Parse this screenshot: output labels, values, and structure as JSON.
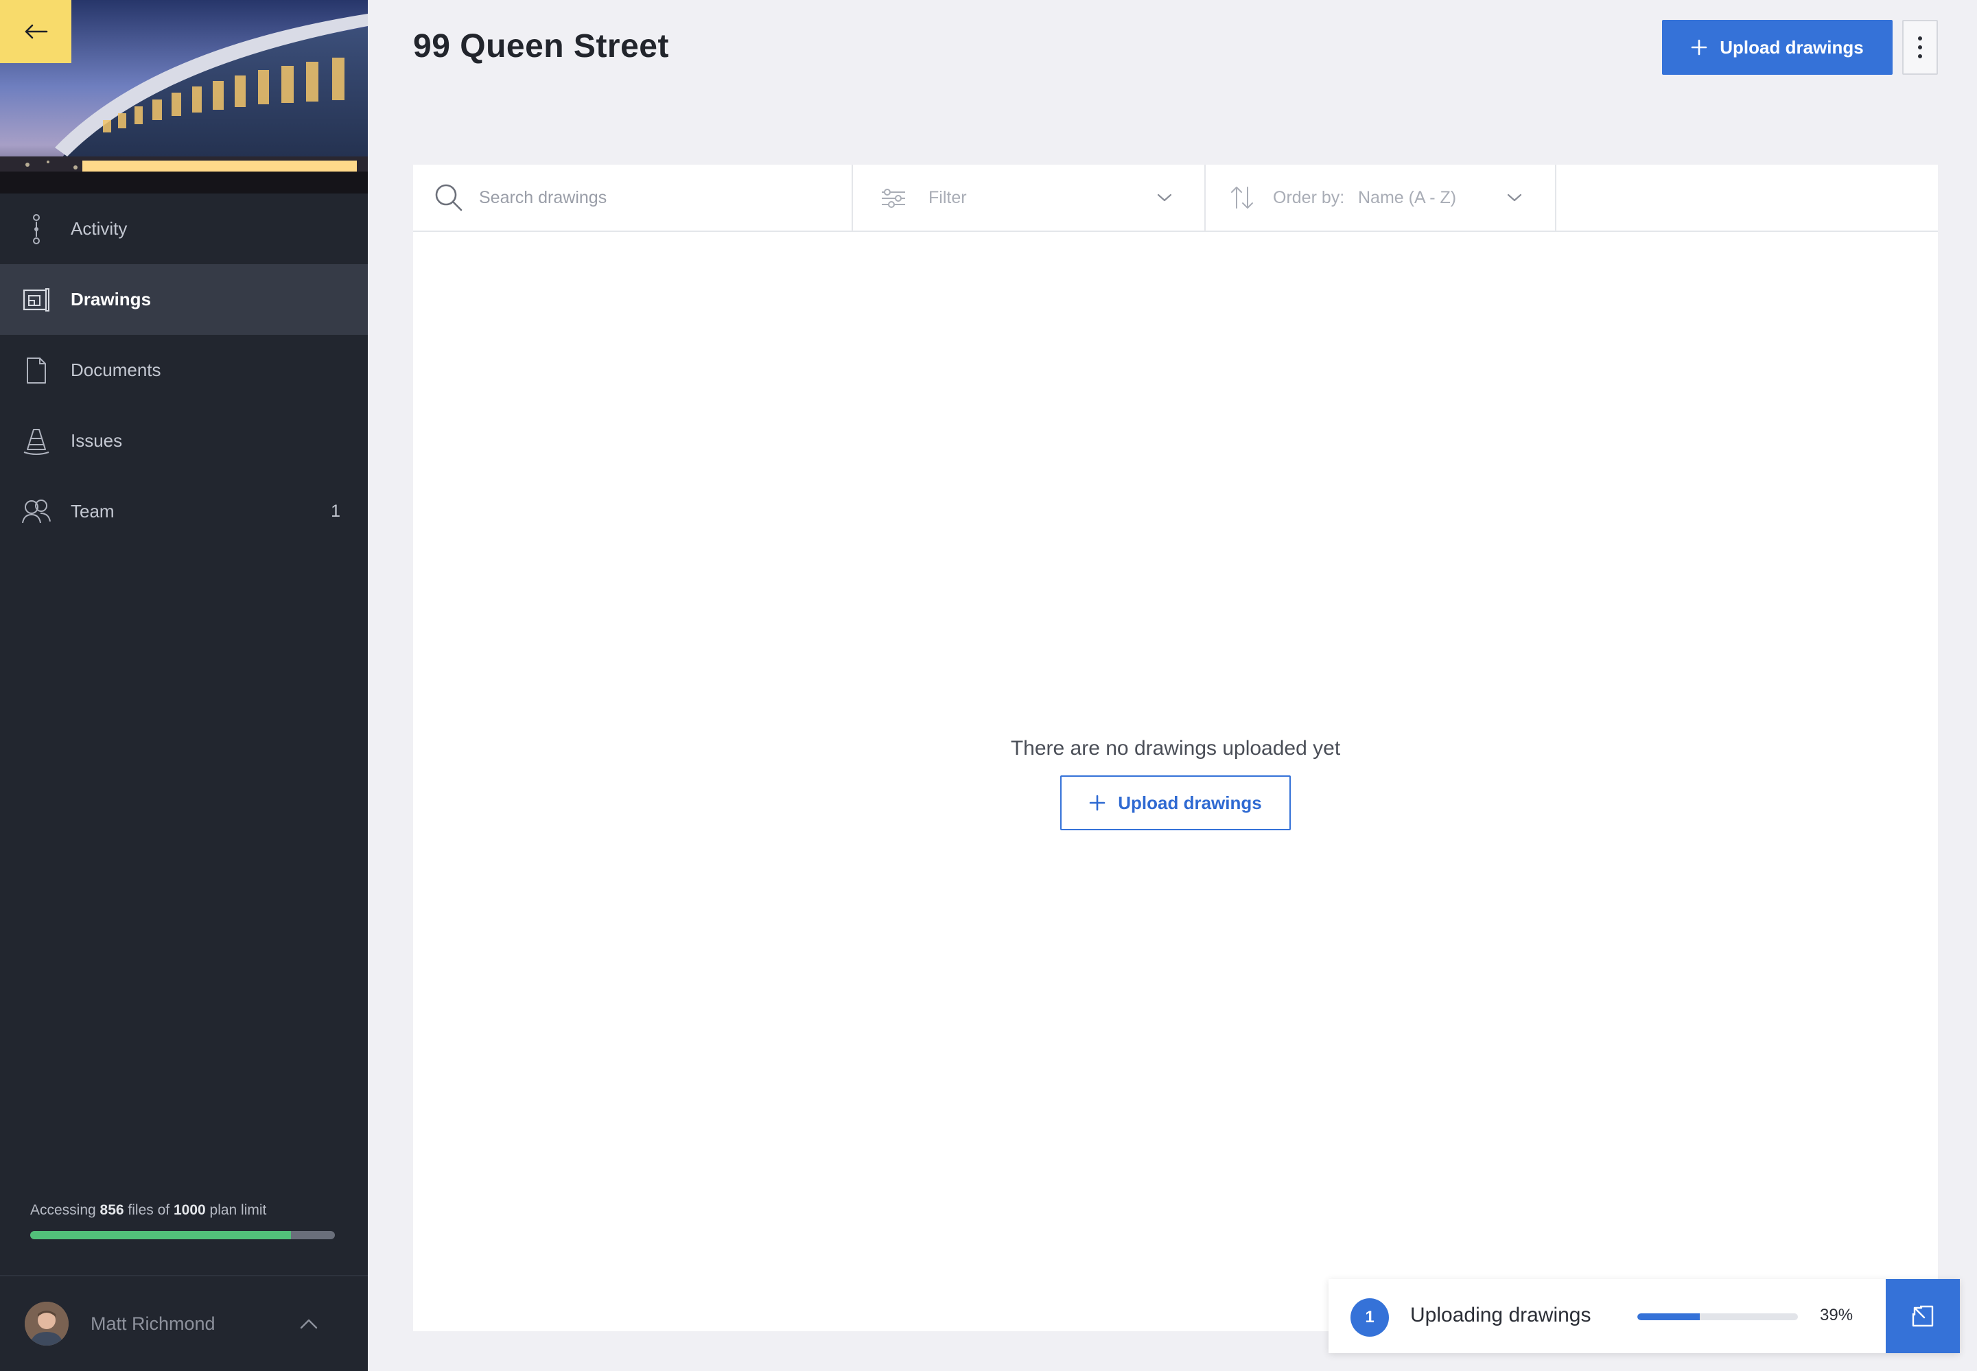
{
  "project": {
    "title": "99 Queen Street"
  },
  "sidebar": {
    "back_icon": "arrow-left-icon",
    "items": [
      {
        "label": "Activity",
        "icon": "activity-icon",
        "active": false,
        "count": ""
      },
      {
        "label": "Drawings",
        "icon": "drawings-icon",
        "active": true,
        "count": ""
      },
      {
        "label": "Documents",
        "icon": "document-icon",
        "active": false,
        "count": ""
      },
      {
        "label": "Issues",
        "icon": "cone-icon",
        "active": false,
        "count": ""
      },
      {
        "label": "Team",
        "icon": "team-icon",
        "active": false,
        "count": "1"
      }
    ],
    "plan": {
      "prefix": "Accessing ",
      "used": "856",
      "middle": " files of ",
      "limit": "1000",
      "suffix": " plan limit",
      "used_fraction": 0.856
    },
    "user": {
      "name": "Matt Richmond"
    }
  },
  "header": {
    "upload_label": "Upload drawings",
    "more_icon": "more-vertical-icon"
  },
  "toolbar": {
    "search_placeholder": "Search drawings",
    "filter_label": "Filter",
    "order_prefix": "Order by:",
    "order_value": "Name (A - Z)"
  },
  "empty_state": {
    "message": "There are no drawings uploaded yet",
    "upload_label": "Upload drawings"
  },
  "upload_toast": {
    "count": "1",
    "title": "Uploading drawings",
    "progress_percent": 39,
    "progress_label": "39%"
  },
  "colors": {
    "accent": "#3572d8",
    "sidebar_bg": "#22262f",
    "back_button": "#f8db6b",
    "plan_bar": "#52c07a"
  }
}
